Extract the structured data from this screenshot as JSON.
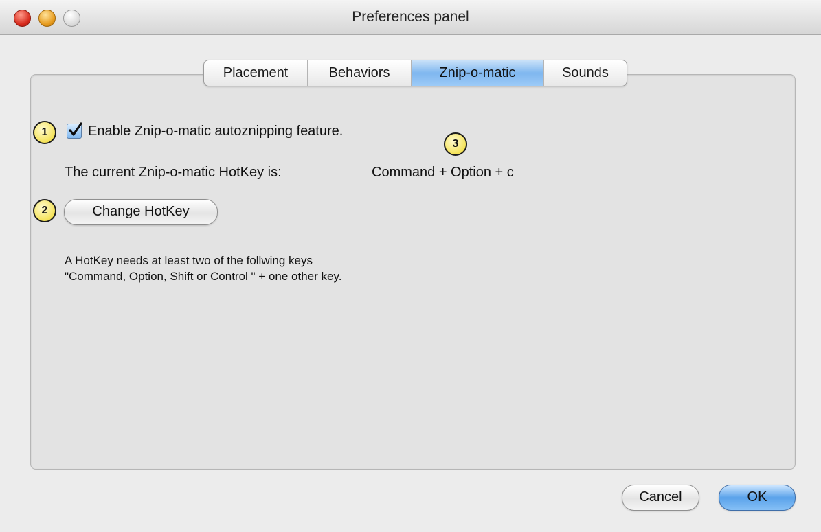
{
  "window": {
    "title": "Preferences panel"
  },
  "tabs": [
    {
      "label": "Placement",
      "selected": false
    },
    {
      "label": "Behaviors",
      "selected": false
    },
    {
      "label": "Znip-o-matic",
      "selected": true
    },
    {
      "label": "Sounds",
      "selected": false
    }
  ],
  "callouts": {
    "one": "1",
    "two": "2",
    "three": "3"
  },
  "enable_checkbox": {
    "label": "Enable Znip-o-matic autoznipping feature.",
    "checked": true
  },
  "hotkey": {
    "label": "The current Znip-o-matic HotKey is:",
    "value": "Command + Option + c"
  },
  "change_hotkey_button": "Change HotKey",
  "note": {
    "line1": "A HotKey needs at least two of the follwing keys",
    "line2": "\"Command, Option, Shift or Control \" + one other key."
  },
  "footer": {
    "cancel_label": "Cancel",
    "ok_label": "OK"
  },
  "colors": {
    "selected_tab": "#7fb7ef",
    "ok_button": "#5aa2ea",
    "callout_fill": "#f5e35a"
  }
}
